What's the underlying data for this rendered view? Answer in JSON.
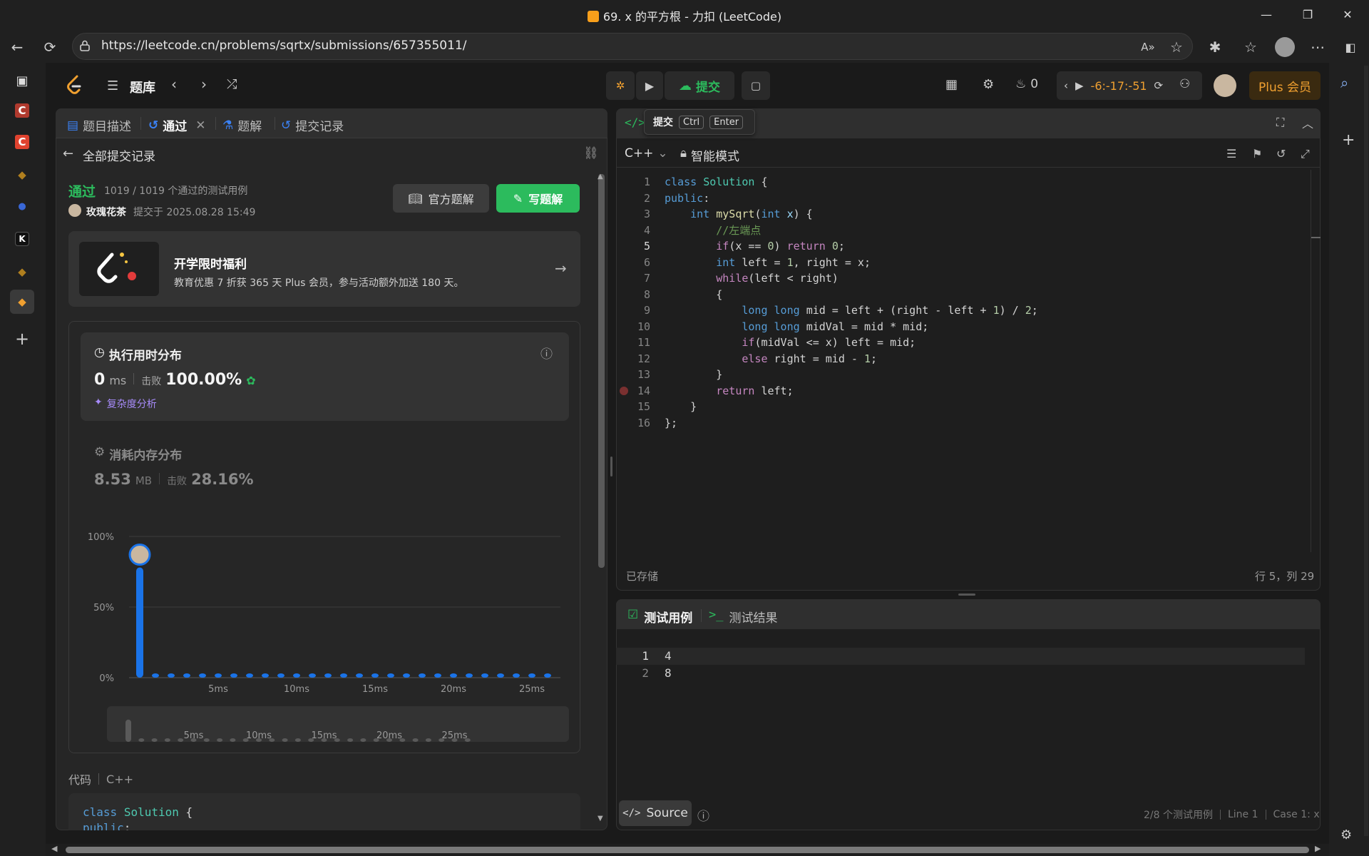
{
  "window": {
    "title": "69. x 的平方根 - 力扣 (LeetCode)"
  },
  "browser": {
    "url": "https://leetcode.cn/problems/sqrtx/submissions/657355011/"
  },
  "app": {
    "problem_bank": "题库",
    "submit_label": "提交",
    "streak_count": "0",
    "timer": "-6:-17:-51",
    "plus_label": "Plus 会员",
    "tooltip": {
      "label": "提交",
      "key1": "Ctrl",
      "key2": "Enter"
    }
  },
  "left": {
    "tabs": [
      {
        "label": "题目描述"
      },
      {
        "label": "通过"
      },
      {
        "label": "题解"
      },
      {
        "label": "提交记录"
      }
    ],
    "back_label": "全部提交记录",
    "status": "通过",
    "cases": "1019 / 1019 个通过的测试用例",
    "user": "玫瑰花茶",
    "submitted_at": "提交于 2025.08.28 15:49",
    "btn_official": "官方题解",
    "btn_write": "写题解",
    "promo": {
      "title": "开学限时福利",
      "desc": "教育优惠 7 折获 365 天 Plus 会员，参与活动额外加送 180 天。"
    },
    "runtime": {
      "title": "执行用时分布",
      "value": "0",
      "unit": "ms",
      "beat_label": "击败",
      "beat": "100.00%",
      "analysis": "复杂度分析"
    },
    "memory": {
      "title": "消耗内存分布",
      "value": "8.53",
      "unit": "MB",
      "beat_label": "击败",
      "beat": "28.16%"
    },
    "code_label": "代码",
    "lang": "C++",
    "code_preview": [
      "class Solution {",
      "public:"
    ]
  },
  "chart_data": {
    "type": "bar",
    "title": "执行用时分布",
    "yticks": [
      "100%",
      "50%",
      "0%"
    ],
    "xticks": [
      "5ms",
      "10ms",
      "15ms",
      "20ms",
      "25ms"
    ],
    "ylim": [
      0,
      100
    ],
    "x": [
      0,
      1,
      2,
      3,
      4,
      5,
      6,
      7,
      8,
      9,
      10,
      11,
      12,
      13,
      14,
      15,
      16,
      17,
      18,
      19,
      20,
      21,
      22,
      23,
      24,
      25,
      26
    ],
    "values": [
      78,
      1,
      1,
      2,
      1,
      1,
      1,
      1,
      1,
      1,
      1,
      1,
      1,
      1,
      1,
      1,
      1,
      1,
      1,
      1,
      1,
      1,
      1,
      1,
      1,
      1,
      1
    ],
    "highlight_index": 0
  },
  "editor": {
    "lang": "C++",
    "mode": "智能模式",
    "saved": "已存储",
    "cursor": "行 5，列 29"
  },
  "tests": {
    "tab1": "测试用例",
    "tab2": "测试结果",
    "lines": [
      "4",
      "8"
    ],
    "source_btn": "Source",
    "footer_count": "2/8 个测试用例",
    "footer_line": "Line 1",
    "footer_case": "Case 1: x"
  }
}
